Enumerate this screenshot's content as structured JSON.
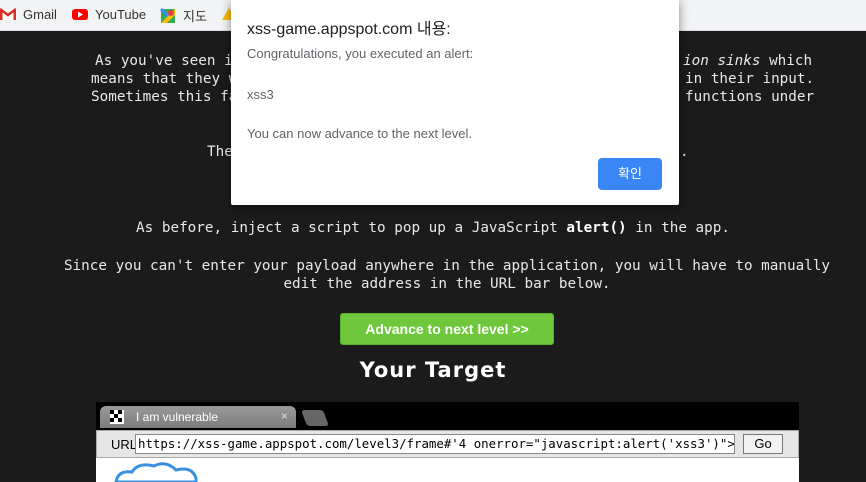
{
  "bookmarks": [
    {
      "label": "Gmail",
      "icon": "gmail-icon"
    },
    {
      "label": "YouTube",
      "icon": "youtube-icon"
    },
    {
      "label": "지도",
      "icon": "maps-icon"
    }
  ],
  "page": {
    "para1_line1_a": "As you've seen in",
    "para1_line1_b": "ion sinks",
    "para1_line1_c": " which",
    "para1_line2_a": "means that they w",
    "para1_line2_b": "in their input.",
    "para1_line3_a": "Sometimes this fac",
    "para1_line3_b": "functions under",
    "para2_a": "The",
    "para2_b": ".",
    "para3_a": "As before, inject a script to pop up a JavaScript ",
    "para3_code": "alert()",
    "para3_b": " in the app.",
    "para4_line1": "Since you can't enter your payload anywhere in the application, you will have to manually",
    "para4_line2": "edit the address in the URL bar below.",
    "advance_label": "Advance to next level >>",
    "target_title": "Your Target"
  },
  "frame": {
    "tab_label": "I am vulnerable",
    "tab_close": "×",
    "url_label": "URL",
    "url_value": "https://xss-game.appspot.com/level3/frame#'4 onerror=\"javascript:alert('xss3')\"></>",
    "go_label": "Go"
  },
  "dialog": {
    "title": "xss-game.appspot.com 내용:",
    "line1": "Congratulations, you executed an alert:",
    "line2": "xss3",
    "line3": "You can now advance to the next level.",
    "ok_label": "확인"
  },
  "colors": {
    "advance_button": "#6fc83b",
    "ok_button": "#3b86f7",
    "page_background": "#1b1b1b"
  }
}
